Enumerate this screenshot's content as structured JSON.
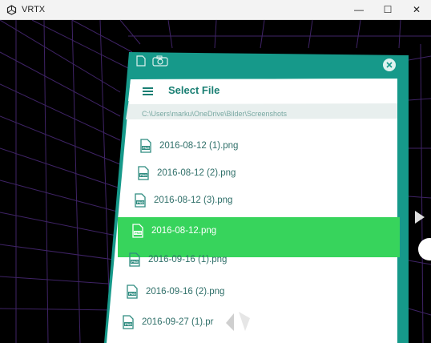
{
  "window": {
    "title": "VRTX",
    "controls": {
      "minimize": "—",
      "maximize": "☐",
      "close": "✕"
    }
  },
  "panel": {
    "header_title": "Select File",
    "path": "C:\\Users\\marku\\OneDrive\\Bilder\\Screenshots",
    "files": [
      {
        "name": "2016-08-12 (1).png",
        "badge": "PNG",
        "selected": false
      },
      {
        "name": "2016-08-12 (2).png",
        "badge": "PNG",
        "selected": false
      },
      {
        "name": "2016-08-12 (3).png",
        "badge": "PNG",
        "selected": false
      },
      {
        "name": "2016-08-12.png",
        "badge": "PNG",
        "selected": true
      },
      {
        "name": "2016-09-16 (1).png",
        "badge": "PNG",
        "selected": false
      },
      {
        "name": "2016-09-16 (2).png",
        "badge": "PNG",
        "selected": false
      },
      {
        "name": "2016-09-27 (1).pr",
        "badge": "PNG",
        "selected": false
      }
    ]
  },
  "colors": {
    "panel_teal": "#16998a",
    "selection_green": "#37d45c",
    "grid_purple": "#5a2a8a"
  }
}
